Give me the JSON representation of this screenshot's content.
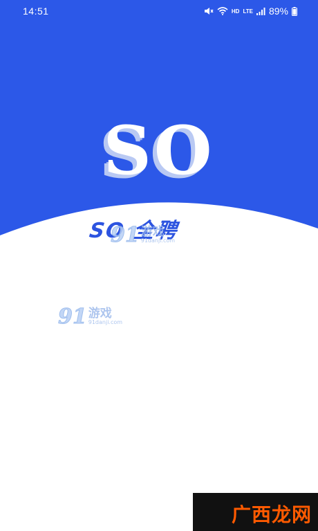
{
  "colors": {
    "brand_blue": "#2c58e8",
    "background": "#ffffff",
    "brand_text": "#2d54e0",
    "corner_orange": "#ff5a00"
  },
  "status_bar": {
    "time": "14:51",
    "network_hd": "HD",
    "network_lte": "LTE",
    "battery": "89%",
    "icons": [
      "mute-icon",
      "wifi-icon",
      "signal-icon",
      "battery-icon"
    ]
  },
  "splash": {
    "logo": "SO",
    "brand_name": "SO 全聘"
  },
  "watermarks": {
    "site_a_number": "91",
    "site_a_name": "游戏",
    "site_a_url": "91danji.com",
    "site_b_text": "广西龙网"
  }
}
